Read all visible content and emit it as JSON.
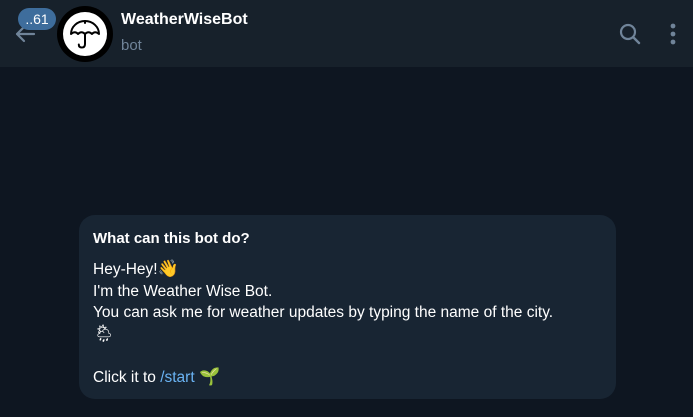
{
  "header": {
    "unread_count": "..61",
    "bot_name": "WeatherWiseBot",
    "status": "bot",
    "avatar_icon": "umbrella-icon",
    "back_icon": "arrow-left-icon",
    "search_icon": "search-icon",
    "menu_icon": "more-vertical-icon"
  },
  "intro": {
    "title": "What can this bot do?",
    "greeting": "Hey-Hey!",
    "greeting_emoji": "👋",
    "line2": "I'm the Weather Wise Bot.",
    "line3": "You can ask me for weather updates by typing the name of the city.",
    "weather_emoji": "🌦",
    "cta_prefix": "Click it to ",
    "cta_command": "/start",
    "cta_emoji": "🌱"
  },
  "colors": {
    "background": "#0e1621",
    "header": "#17212b",
    "card": "#182533",
    "link": "#6ab3f3",
    "badge": "#3e6d9c",
    "muted": "#708499"
  }
}
